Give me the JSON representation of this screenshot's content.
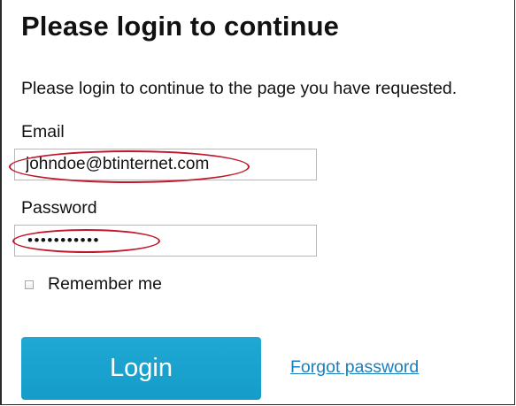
{
  "page": {
    "title": "Please login to continue",
    "intro": "Please login to continue to the page you have requested."
  },
  "form": {
    "email_label": "Email",
    "email_value": "johndoe@btinternet.com",
    "password_label": "Password",
    "password_value": "•••••••••••",
    "remember_label": "Remember me",
    "remember_checked": false,
    "login_label": "Login",
    "forgot_label": "Forgot password"
  },
  "colors": {
    "button": "#1ba3d0",
    "link": "#1a7fbf",
    "annotation": "#c0172a"
  }
}
